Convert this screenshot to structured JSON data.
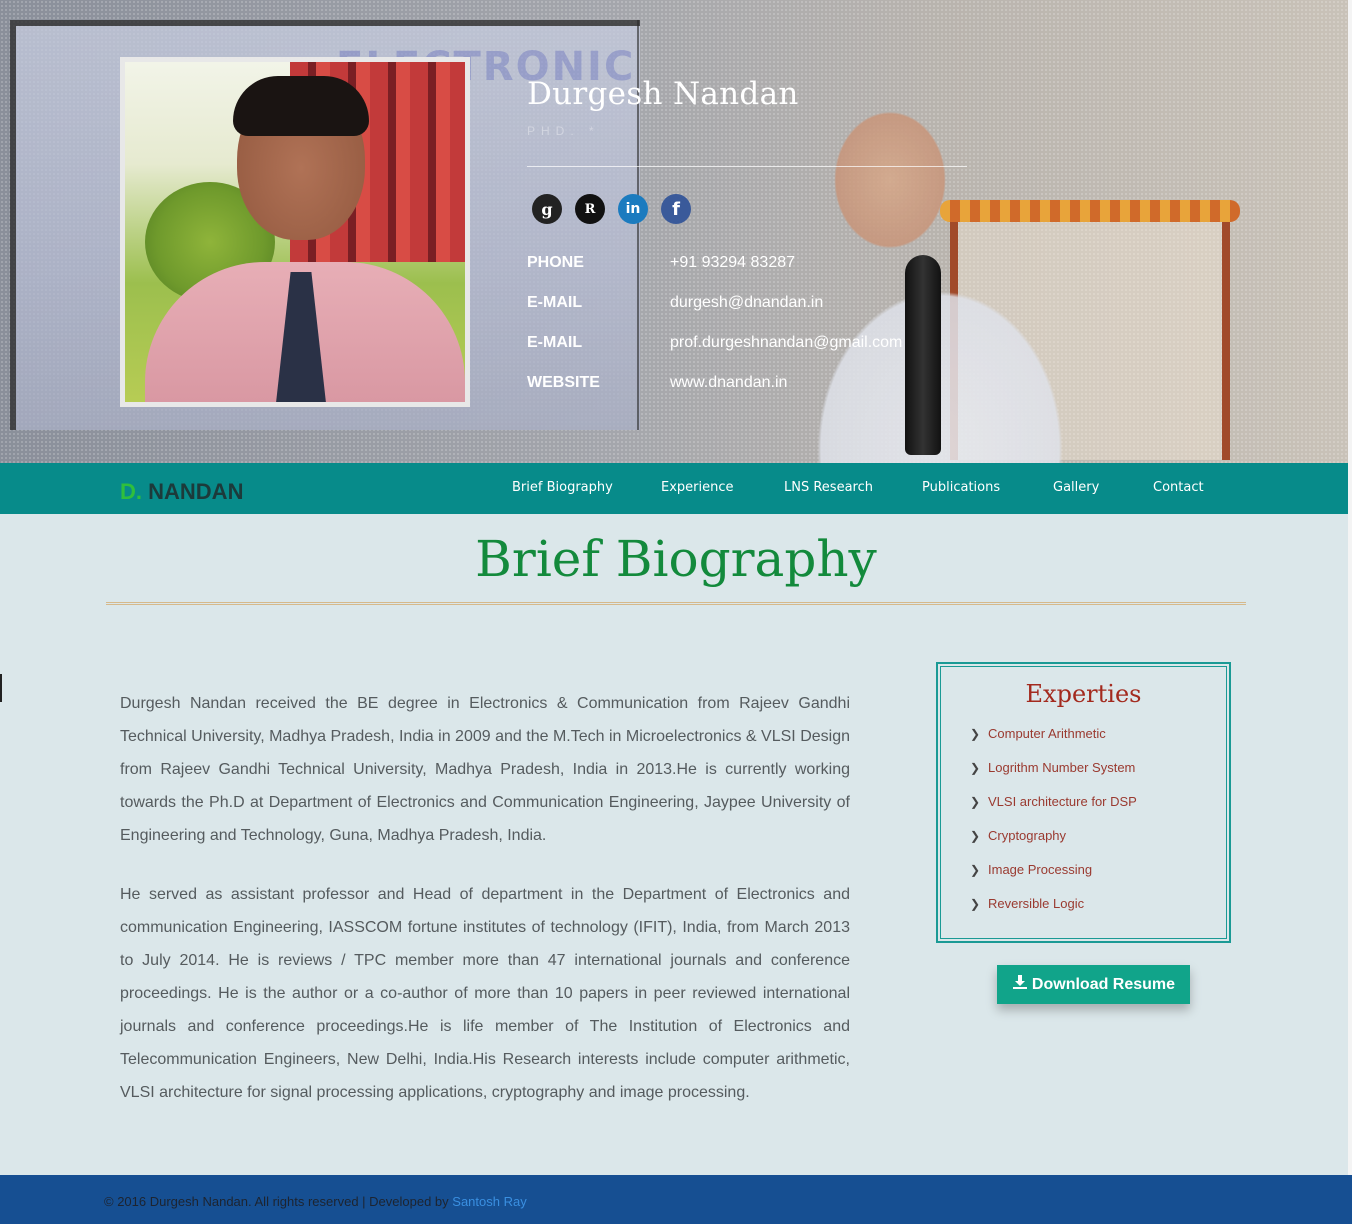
{
  "hero": {
    "name": "Durgesh Nandan",
    "degree": "PHD. *",
    "background_text": "ELECTRONIC",
    "socials": [
      {
        "icon": "google-scholar-icon",
        "glyph": "g"
      },
      {
        "icon": "researchgate-icon",
        "glyph": "R"
      },
      {
        "icon": "linkedin-icon",
        "glyph": "in"
      },
      {
        "icon": "facebook-icon",
        "glyph": "f"
      }
    ],
    "contacts": [
      {
        "label": "PHONE",
        "value": "+91 93294 83287"
      },
      {
        "label": "E-MAIL",
        "value": "durgesh@dnandan.in"
      },
      {
        "label": "E-MAIL",
        "value": "prof.durgeshnandan@gmail.com"
      },
      {
        "label": "WEBSITE",
        "value": "www.dnandan.in"
      }
    ]
  },
  "nav": {
    "brand_initial": "D.",
    "brand_name": "NANDAN",
    "links": [
      "Brief Biography",
      "Experience",
      "LNS Research",
      "Publications",
      "Gallery",
      "Contact"
    ]
  },
  "main": {
    "title": "Brief Biography",
    "bio_paragraphs": [
      "Durgesh Nandan received the BE degree in Electronics & Communication from Rajeev Gandhi Technical University, Madhya Pradesh, India in 2009 and the M.Tech in Microelectronics & VLSI Design from Rajeev Gandhi Technical University, Madhya Pradesh, India in 2013.He is currently working towards the Ph.D at Department of Electronics and Communication Engineering, Jaypee University of Engineering and Technology, Guna, Madhya Pradesh, India.",
      "He served as assistant professor and Head of department in the Department of Electronics and communication Engineering, IASSCOM fortune institutes of technology (IFIT), India, from March 2013 to July 2014. He is reviews / TPC member more than 47 international journals and conference proceedings. He is the author or a co-author of more than 10 papers in peer reviewed international journals and conference proceedings.He is life member of The Institution of Electronics and Telecommunication Engineers, New Delhi, India.His Research interests include computer arithmetic, VLSI architecture for signal processing applications, cryptography and image processing."
    ],
    "experties": {
      "title": "Experties",
      "items": [
        "Computer Arithmetic",
        "Logrithm Number System",
        "VLSI architecture for DSP",
        "Cryptography",
        "Image Processing",
        "Reversible Logic"
      ]
    },
    "download_label": "Download Resume"
  },
  "footer": {
    "text": "© 2016 Durgesh Nandan. All rights reserved | Developed by",
    "link": "Santosh Ray"
  },
  "colors": {
    "nav_bg": "#078b8a",
    "title_green": "#138a3c",
    "experties_red": "#a32a1e",
    "button_teal": "#11a48a",
    "footer_blue": "#164f92"
  }
}
